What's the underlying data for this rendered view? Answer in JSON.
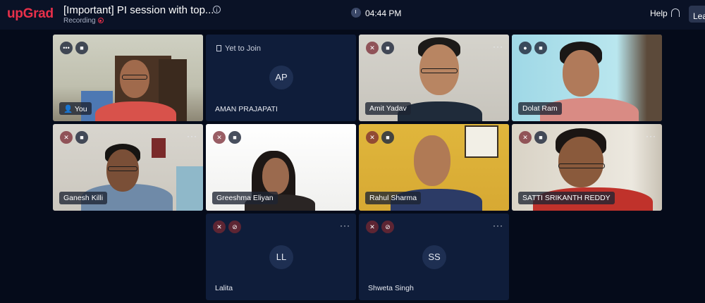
{
  "app": {
    "logo": "upGrad"
  },
  "header": {
    "title": "[Important] PI session with top...",
    "recording_label": "Recording",
    "time": "04:44 PM",
    "help_label": "Help",
    "leave_label": "Lea"
  },
  "icons": {
    "info": "info-icon",
    "clock": "clock-icon",
    "headset": "headset-icon",
    "mic": "mic-icon",
    "mic_muted": "mic-muted-icon",
    "camera": "camera-icon",
    "camera_off": "camera-off-icon",
    "more": "more-icon",
    "user": "user-icon",
    "doc": "doc-icon"
  },
  "grid": {
    "tiles": [
      {
        "name": "You",
        "type": "video",
        "mic": "none",
        "camera": "on"
      },
      {
        "name": "AMAN PRAJAPATI",
        "type": "pending",
        "status": "Yet to Join",
        "initials": "AP"
      },
      {
        "name": "Amit Yadav",
        "type": "video",
        "mic": "muted",
        "camera": "on"
      },
      {
        "name": "Dolat Ram",
        "type": "video",
        "mic": "on",
        "camera": "on"
      },
      {
        "name": "Ganesh Killi",
        "type": "video",
        "mic": "muted",
        "camera": "on"
      },
      {
        "name": "Greeshma Eliyan",
        "type": "video",
        "mic": "muted",
        "camera": "on"
      },
      {
        "name": "Rahul Sharma",
        "type": "video",
        "mic": "muted",
        "camera": "on"
      },
      {
        "name": "SATTI SRIKANTH REDDY",
        "type": "video",
        "mic": "muted",
        "camera": "on"
      },
      {
        "name": "Lalita",
        "type": "avatar",
        "initials": "LL",
        "mic": "muted",
        "camera": "off"
      },
      {
        "name": "Shweta Singh",
        "type": "avatar",
        "initials": "SS",
        "mic": "muted",
        "camera": "off"
      }
    ]
  },
  "colors": {
    "brand": "#e8304a",
    "background": "#050b1a",
    "tile_empty": "#0f1d3a",
    "header": "#0a1226"
  }
}
